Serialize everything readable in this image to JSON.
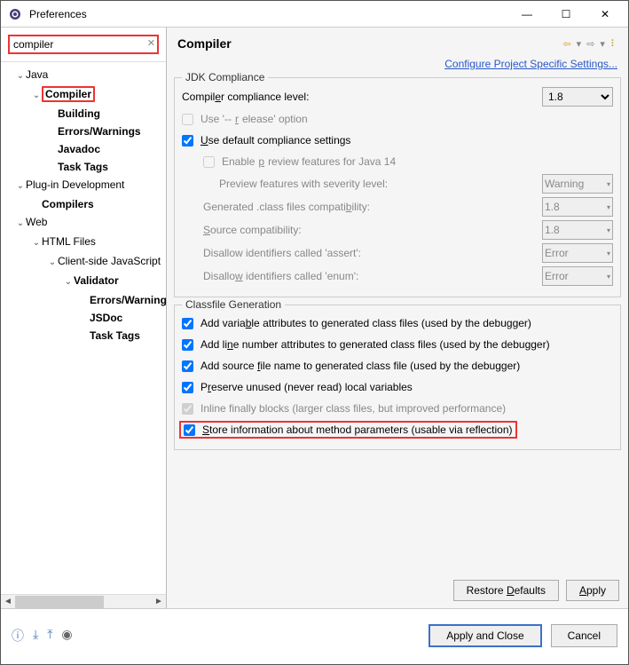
{
  "window": {
    "title": "Preferences"
  },
  "search": {
    "value": "compiler"
  },
  "tree": {
    "java": "Java",
    "java_compiler": "Compiler",
    "building": "Building",
    "errors_warnings": "Errors/Warnings",
    "javadoc": "Javadoc",
    "task_tags": "Task Tags",
    "plugin_dev": "Plug-in Development",
    "compilers": "Compilers",
    "web": "Web",
    "html_files": "HTML Files",
    "client_js": "Client-side JavaScript",
    "validator": "Validator",
    "errors_warnings2": "Errors/Warnings",
    "jsdoc": "JSDoc",
    "task_tags2": "Task Tags"
  },
  "main": {
    "title": "Compiler",
    "link": "Configure Project Specific Settings..."
  },
  "jdk": {
    "group": "JDK Compliance",
    "compliance_label": "Compiler compliance level:",
    "compliance_value": "1.8",
    "use_release": "Use '--release' option",
    "use_default": "Use default compliance settings",
    "enable_preview": "Enable preview features for Java 14",
    "preview_severity": "Preview features with severity level:",
    "preview_severity_value": "Warning",
    "generated_class": "Generated .class files compatibility:",
    "generated_class_value": "1.8",
    "source_compat": "Source compatibility:",
    "source_compat_value": "1.8",
    "disallow_assert": "Disallow identifiers called 'assert':",
    "disallow_assert_value": "Error",
    "disallow_enum": "Disallow identifiers called 'enum':",
    "disallow_enum_value": "Error"
  },
  "classfile": {
    "group": "Classfile Generation",
    "var_attrs": "Add variable attributes to generated class files (used by the debugger)",
    "line_numbers": "Add line number attributes to generated class files (used by the debugger)",
    "source_file": "Add source file name to generated class file (used by the debugger)",
    "preserve_unused": "Preserve unused (never read) local variables",
    "inline_finally": "Inline finally blocks (larger class files, but improved performance)",
    "store_method": "Store information about method parameters (usable via reflection)"
  },
  "buttons": {
    "restore": "Restore Defaults",
    "apply": "Apply",
    "apply_close": "Apply and Close",
    "cancel": "Cancel"
  }
}
